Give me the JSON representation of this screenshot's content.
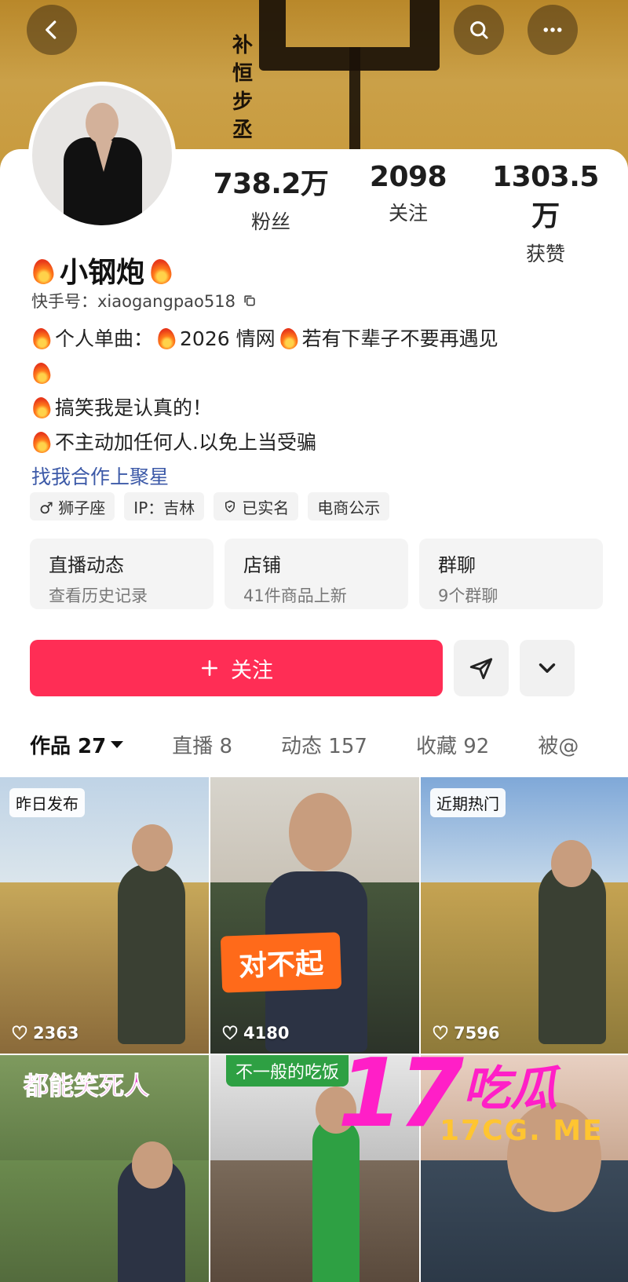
{
  "header": {
    "back_icon": "chevron-left-icon",
    "search_icon": "search-icon",
    "more_icon": "more-icon",
    "banner_calligraphy": "补 恒 步 丞"
  },
  "profile": {
    "name": "小钢炮",
    "kuaishou_id_label": "快手号：xiaogangpao518",
    "stats": [
      {
        "value": "738.2万",
        "label": "粉丝"
      },
      {
        "value": "2098",
        "label": "关注"
      },
      {
        "value": "1303.5万",
        "label": "获赞"
      }
    ],
    "bio": {
      "line1_a": "个人单曲：",
      "line1_b": "2026 情网",
      "line1_c": "若有下辈子不要再遇见",
      "line2": "搞笑我是认真的！",
      "line3": "不主动加任何人.以免上当受骗",
      "link": "找我合作上聚星"
    },
    "tags": [
      "♂ 狮子座",
      "IP：吉林",
      "已实名",
      "电商公示"
    ]
  },
  "features": [
    {
      "title": "直播动态",
      "subtitle": "查看历史记录"
    },
    {
      "title": "店铺",
      "subtitle": "41件商品上新"
    },
    {
      "title": "群聊",
      "subtitle": "9个群聊"
    }
  ],
  "actions": {
    "follow_label": "关注",
    "follow_color": "#ff2d55"
  },
  "tabs": [
    {
      "label": "作品 27",
      "active": true
    },
    {
      "label": "直播 8"
    },
    {
      "label": "动态 157"
    },
    {
      "label": "收藏 92"
    },
    {
      "label": "被@"
    }
  ],
  "videos": [
    {
      "badge": "昨日发布",
      "likes": "2363"
    },
    {
      "badge": "",
      "overlay": "对不起",
      "likes": "4180"
    },
    {
      "badge": "近期热门",
      "likes": "7596"
    },
    {
      "overlay": "都能笑死人"
    },
    {
      "overlay": "不一般的吃饭"
    },
    {
      "overlay": ""
    }
  ],
  "watermark": {
    "big": "17",
    "cn": "吃瓜",
    "url": "17CG. ME"
  }
}
